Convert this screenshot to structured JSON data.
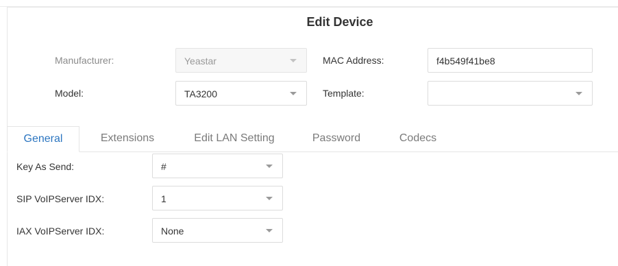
{
  "dialog": {
    "title": "Edit Device"
  },
  "device": {
    "manufacturer_label": "Manufacturer:",
    "manufacturer_value": "Yeastar",
    "mac_label": "MAC Address:",
    "mac_value": "f4b549f41be8",
    "model_label": "Model:",
    "model_value": "TA3200",
    "template_label": "Template:",
    "template_value": ""
  },
  "tabs": [
    {
      "label": "General",
      "active": true
    },
    {
      "label": "Extensions",
      "active": false
    },
    {
      "label": "Edit LAN Setting",
      "active": false
    },
    {
      "label": "Password",
      "active": false
    },
    {
      "label": "Codecs",
      "active": false
    }
  ],
  "general": {
    "key_as_send_label": "Key As Send:",
    "key_as_send_value": "#",
    "sip_idx_label": "SIP VoIPServer IDX:",
    "sip_idx_value": "1",
    "iax_idx_label": "IAX VoIPServer IDX:",
    "iax_idx_value": "None"
  },
  "colors": {
    "accent": "#2b75c0",
    "border": "#dcdcdc",
    "muted_text": "#8a8a8a"
  }
}
